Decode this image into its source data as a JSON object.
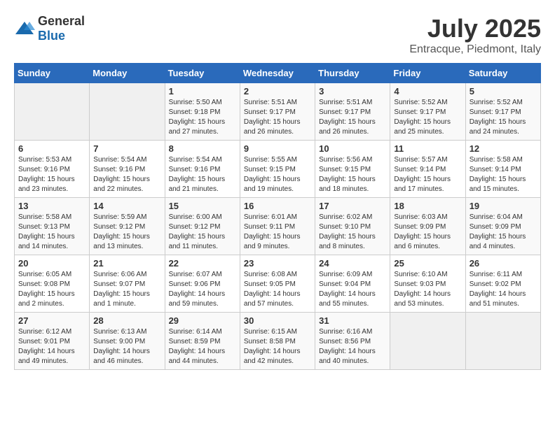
{
  "logo": {
    "general": "General",
    "blue": "Blue"
  },
  "header": {
    "month": "July 2025",
    "location": "Entracque, Piedmont, Italy"
  },
  "weekdays": [
    "Sunday",
    "Monday",
    "Tuesday",
    "Wednesday",
    "Thursday",
    "Friday",
    "Saturday"
  ],
  "weeks": [
    [
      {
        "day": null
      },
      {
        "day": null
      },
      {
        "day": "1",
        "sunrise": "Sunrise: 5:50 AM",
        "sunset": "Sunset: 9:18 PM",
        "daylight": "Daylight: 15 hours and 27 minutes."
      },
      {
        "day": "2",
        "sunrise": "Sunrise: 5:51 AM",
        "sunset": "Sunset: 9:17 PM",
        "daylight": "Daylight: 15 hours and 26 minutes."
      },
      {
        "day": "3",
        "sunrise": "Sunrise: 5:51 AM",
        "sunset": "Sunset: 9:17 PM",
        "daylight": "Daylight: 15 hours and 26 minutes."
      },
      {
        "day": "4",
        "sunrise": "Sunrise: 5:52 AM",
        "sunset": "Sunset: 9:17 PM",
        "daylight": "Daylight: 15 hours and 25 minutes."
      },
      {
        "day": "5",
        "sunrise": "Sunrise: 5:52 AM",
        "sunset": "Sunset: 9:17 PM",
        "daylight": "Daylight: 15 hours and 24 minutes."
      }
    ],
    [
      {
        "day": "6",
        "sunrise": "Sunrise: 5:53 AM",
        "sunset": "Sunset: 9:16 PM",
        "daylight": "Daylight: 15 hours and 23 minutes."
      },
      {
        "day": "7",
        "sunrise": "Sunrise: 5:54 AM",
        "sunset": "Sunset: 9:16 PM",
        "daylight": "Daylight: 15 hours and 22 minutes."
      },
      {
        "day": "8",
        "sunrise": "Sunrise: 5:54 AM",
        "sunset": "Sunset: 9:16 PM",
        "daylight": "Daylight: 15 hours and 21 minutes."
      },
      {
        "day": "9",
        "sunrise": "Sunrise: 5:55 AM",
        "sunset": "Sunset: 9:15 PM",
        "daylight": "Daylight: 15 hours and 19 minutes."
      },
      {
        "day": "10",
        "sunrise": "Sunrise: 5:56 AM",
        "sunset": "Sunset: 9:15 PM",
        "daylight": "Daylight: 15 hours and 18 minutes."
      },
      {
        "day": "11",
        "sunrise": "Sunrise: 5:57 AM",
        "sunset": "Sunset: 9:14 PM",
        "daylight": "Daylight: 15 hours and 17 minutes."
      },
      {
        "day": "12",
        "sunrise": "Sunrise: 5:58 AM",
        "sunset": "Sunset: 9:14 PM",
        "daylight": "Daylight: 15 hours and 15 minutes."
      }
    ],
    [
      {
        "day": "13",
        "sunrise": "Sunrise: 5:58 AM",
        "sunset": "Sunset: 9:13 PM",
        "daylight": "Daylight: 15 hours and 14 minutes."
      },
      {
        "day": "14",
        "sunrise": "Sunrise: 5:59 AM",
        "sunset": "Sunset: 9:12 PM",
        "daylight": "Daylight: 15 hours and 13 minutes."
      },
      {
        "day": "15",
        "sunrise": "Sunrise: 6:00 AM",
        "sunset": "Sunset: 9:12 PM",
        "daylight": "Daylight: 15 hours and 11 minutes."
      },
      {
        "day": "16",
        "sunrise": "Sunrise: 6:01 AM",
        "sunset": "Sunset: 9:11 PM",
        "daylight": "Daylight: 15 hours and 9 minutes."
      },
      {
        "day": "17",
        "sunrise": "Sunrise: 6:02 AM",
        "sunset": "Sunset: 9:10 PM",
        "daylight": "Daylight: 15 hours and 8 minutes."
      },
      {
        "day": "18",
        "sunrise": "Sunrise: 6:03 AM",
        "sunset": "Sunset: 9:09 PM",
        "daylight": "Daylight: 15 hours and 6 minutes."
      },
      {
        "day": "19",
        "sunrise": "Sunrise: 6:04 AM",
        "sunset": "Sunset: 9:09 PM",
        "daylight": "Daylight: 15 hours and 4 minutes."
      }
    ],
    [
      {
        "day": "20",
        "sunrise": "Sunrise: 6:05 AM",
        "sunset": "Sunset: 9:08 PM",
        "daylight": "Daylight: 15 hours and 2 minutes."
      },
      {
        "day": "21",
        "sunrise": "Sunrise: 6:06 AM",
        "sunset": "Sunset: 9:07 PM",
        "daylight": "Daylight: 15 hours and 1 minute."
      },
      {
        "day": "22",
        "sunrise": "Sunrise: 6:07 AM",
        "sunset": "Sunset: 9:06 PM",
        "daylight": "Daylight: 14 hours and 59 minutes."
      },
      {
        "day": "23",
        "sunrise": "Sunrise: 6:08 AM",
        "sunset": "Sunset: 9:05 PM",
        "daylight": "Daylight: 14 hours and 57 minutes."
      },
      {
        "day": "24",
        "sunrise": "Sunrise: 6:09 AM",
        "sunset": "Sunset: 9:04 PM",
        "daylight": "Daylight: 14 hours and 55 minutes."
      },
      {
        "day": "25",
        "sunrise": "Sunrise: 6:10 AM",
        "sunset": "Sunset: 9:03 PM",
        "daylight": "Daylight: 14 hours and 53 minutes."
      },
      {
        "day": "26",
        "sunrise": "Sunrise: 6:11 AM",
        "sunset": "Sunset: 9:02 PM",
        "daylight": "Daylight: 14 hours and 51 minutes."
      }
    ],
    [
      {
        "day": "27",
        "sunrise": "Sunrise: 6:12 AM",
        "sunset": "Sunset: 9:01 PM",
        "daylight": "Daylight: 14 hours and 49 minutes."
      },
      {
        "day": "28",
        "sunrise": "Sunrise: 6:13 AM",
        "sunset": "Sunset: 9:00 PM",
        "daylight": "Daylight: 14 hours and 46 minutes."
      },
      {
        "day": "29",
        "sunrise": "Sunrise: 6:14 AM",
        "sunset": "Sunset: 8:59 PM",
        "daylight": "Daylight: 14 hours and 44 minutes."
      },
      {
        "day": "30",
        "sunrise": "Sunrise: 6:15 AM",
        "sunset": "Sunset: 8:58 PM",
        "daylight": "Daylight: 14 hours and 42 minutes."
      },
      {
        "day": "31",
        "sunrise": "Sunrise: 6:16 AM",
        "sunset": "Sunset: 8:56 PM",
        "daylight": "Daylight: 14 hours and 40 minutes."
      },
      {
        "day": null
      },
      {
        "day": null
      }
    ]
  ]
}
